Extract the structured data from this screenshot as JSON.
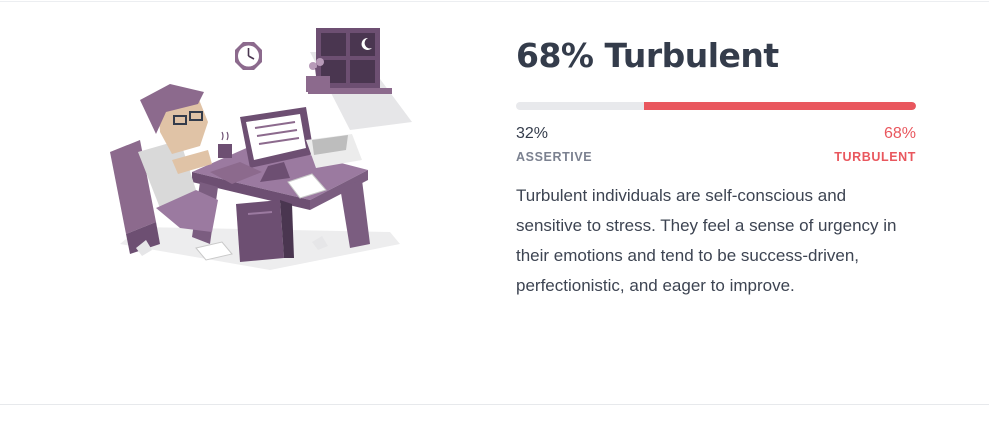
{
  "trait": {
    "title": "68% Turbulent",
    "accent_color": "#e9575e",
    "track_color": "#e8e9ec"
  },
  "meter": {
    "turbulent_fraction": 0.68,
    "assertive_fraction": 0.32
  },
  "left_side": {
    "percent": "32%",
    "label": "ASSERTIVE"
  },
  "right_side": {
    "percent": "68%",
    "label": "TURBULENT"
  },
  "description": "Turbulent individuals are self-conscious and sensitive to stress. They feel a sense of urgency in their emotions and tend to be success-driven, perfectionistic, and eager to improve.",
  "illustration": {
    "icon": "stressed-worker-at-desk-illustration",
    "palette": [
      "#8c6a8d",
      "#6d4f72",
      "#b79ab8",
      "#e0c3a6",
      "#d9d9d9"
    ]
  }
}
